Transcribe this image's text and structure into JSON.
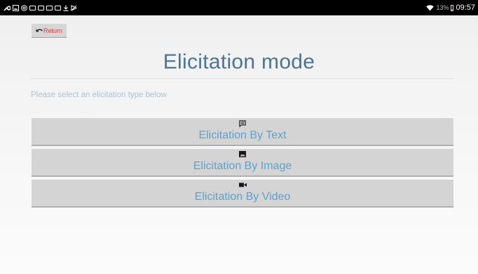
{
  "statusbar": {
    "left_icons": [
      "wrench-icon",
      "image-icon",
      "at-icon",
      "message-icon",
      "message-icon",
      "message-icon",
      "message-icon",
      "download-icon",
      "media-icon"
    ],
    "battery_text": "13%",
    "battery_level": 0.13,
    "time": "09:57"
  },
  "return_button": {
    "label": "Return",
    "icon": "undo-arrow-icon"
  },
  "page_title": "Elicitation mode",
  "subtitle": "Please select an elicitation type below",
  "options": [
    {
      "label": "Elicitation By Text",
      "icon": "message-icon"
    },
    {
      "label": "Elicitation By Image",
      "icon": "image-icon"
    },
    {
      "label": "Elicitation By Video",
      "icon": "videocam-icon"
    }
  ],
  "colors": {
    "title": "#4a7597",
    "option_text": "#5ea1cc",
    "subtitle": "#a9c4d6",
    "return_text": "#e53935",
    "button_bg": "#d4d4d4"
  }
}
